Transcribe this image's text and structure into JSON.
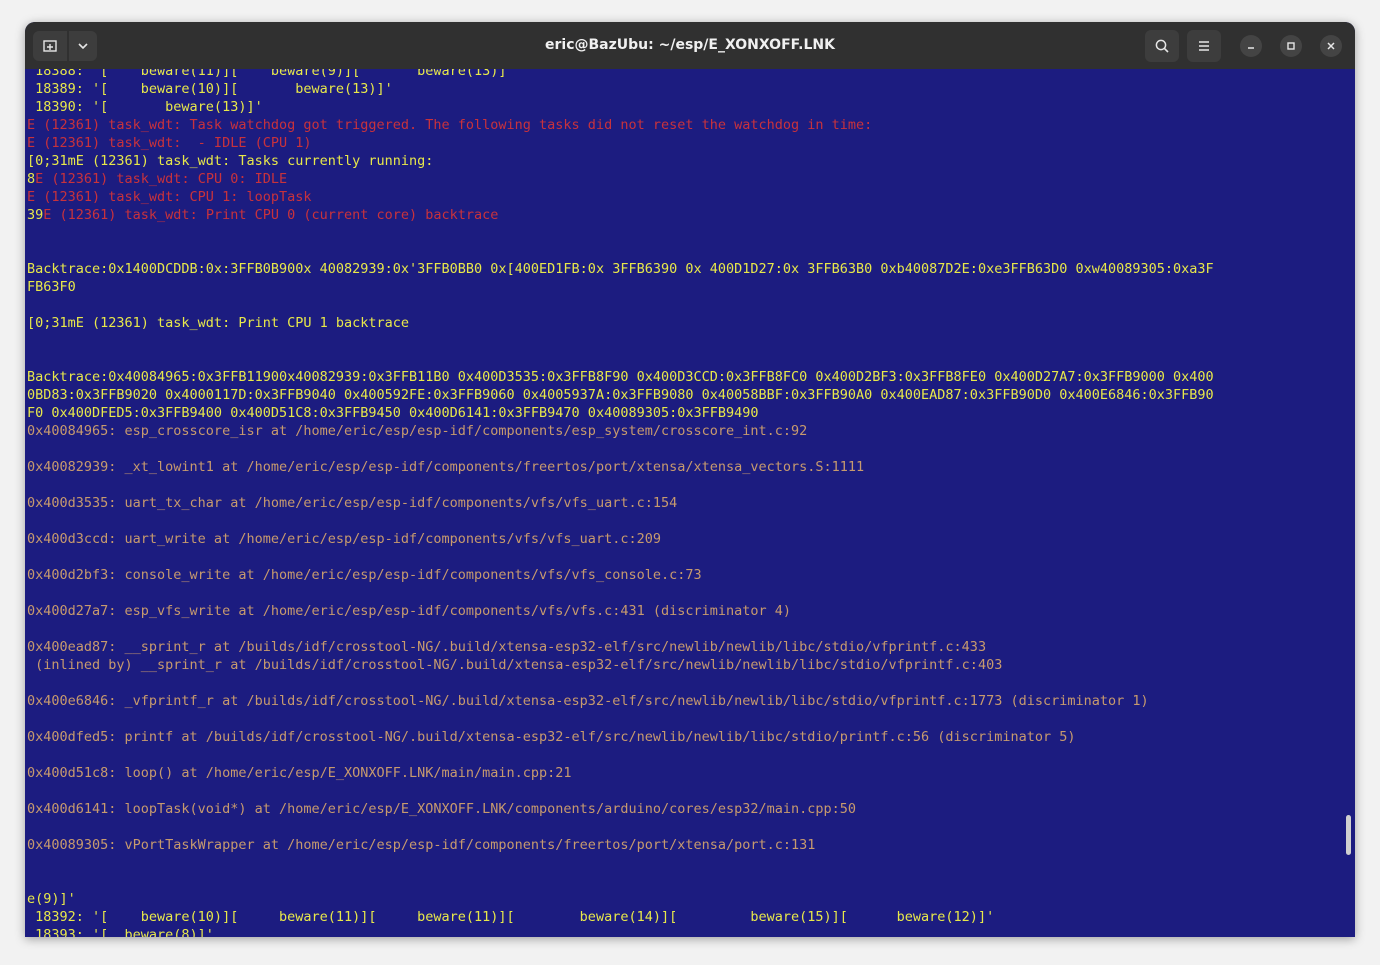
{
  "window": {
    "title": "eric@BazUbu: ~/esp/E_XONXOFF.LNK"
  },
  "colors": {
    "background": "#1c1c80",
    "yellow": "#e8e84a",
    "red": "#c8323c",
    "brown": "#c79a6e",
    "titlebar": "#303030"
  },
  "terminal": {
    "lines": [
      {
        "segments": [
          {
            "text": " 18388: '[    beware(11)][    beware(9)][       beware(13)]'",
            "color": "yellow"
          }
        ]
      },
      {
        "segments": [
          {
            "text": " 18389: '[    beware(10)][       beware(13)]'",
            "color": "yellow"
          }
        ]
      },
      {
        "segments": [
          {
            "text": " 18390: '[       beware(13)]'",
            "color": "yellow"
          }
        ]
      },
      {
        "segments": [
          {
            "text": "E (12361) task_wdt: Task watchdog got triggered. The following tasks did not reset the watchdog in time:",
            "color": "red"
          }
        ]
      },
      {
        "segments": [
          {
            "text": "E (12361) task_wdt:  - IDLE (CPU 1)",
            "color": "red"
          }
        ]
      },
      {
        "segments": [
          {
            "text": "[0;31mE (12361) task_wdt: Tasks currently running:",
            "color": "yellow"
          }
        ]
      },
      {
        "segments": [
          {
            "text": "8",
            "color": "yellow"
          },
          {
            "text": "E (12361) task_wdt: CPU 0: IDLE",
            "color": "red"
          }
        ]
      },
      {
        "segments": [
          {
            "text": "E (12361) task_wdt: CPU 1: loopTask",
            "color": "red"
          }
        ]
      },
      {
        "segments": [
          {
            "text": "39",
            "color": "yellow"
          },
          {
            "text": "E (12361) task_wdt: Print CPU 0 (current core) backtrace",
            "color": "red"
          }
        ]
      },
      {
        "segments": []
      },
      {
        "segments": []
      },
      {
        "segments": [
          {
            "text": "Backtrace:0x1400DCDDB:0x:3FFB0B900x 40082939:0x'3FFB0BB0 0x[400ED1FB:0x 3FFB6390 0x 400D1D27:0x 3FFB63B0 0xb40087D2E:0xe3FFB63D0 0xw40089305:0xa3F",
            "color": "yellow"
          }
        ]
      },
      {
        "segments": [
          {
            "text": "FB63F0",
            "color": "yellow"
          }
        ]
      },
      {
        "segments": []
      },
      {
        "segments": [
          {
            "text": "[0;31mE (12361) task_wdt: Print CPU 1 backtrace",
            "color": "yellow"
          }
        ]
      },
      {
        "segments": []
      },
      {
        "segments": []
      },
      {
        "segments": [
          {
            "text": "Backtrace:0x40084965:0x3FFB11900x40082939:0x3FFB11B0 0x400D3535:0x3FFB8F90 0x400D3CCD:0x3FFB8FC0 0x400D2BF3:0x3FFB8FE0 0x400D27A7:0x3FFB9000 0x400",
            "color": "yellow"
          }
        ]
      },
      {
        "segments": [
          {
            "text": "0BD83:0x3FFB9020 0x4000117D:0x3FFB9040 0x400592FE:0x3FFB9060 0x4005937A:0x3FFB9080 0x40058BBF:0x3FFB90A0 0x400EAD87:0x3FFB90D0 0x400E6846:0x3FFB90",
            "color": "yellow"
          }
        ]
      },
      {
        "segments": [
          {
            "text": "F0 0x400DFED5:0x3FFB9400 0x400D51C8:0x3FFB9450 0x400D6141:0x3FFB9470 0x40089305:0x3FFB9490",
            "color": "yellow"
          }
        ]
      },
      {
        "segments": [
          {
            "text": "0x40084965: esp_crosscore_isr at /home/eric/esp/esp-idf/components/esp_system/crosscore_int.c:92",
            "color": "brown"
          }
        ]
      },
      {
        "segments": []
      },
      {
        "segments": [
          {
            "text": "0x40082939: _xt_lowint1 at /home/eric/esp/esp-idf/components/freertos/port/xtensa/xtensa_vectors.S:1111",
            "color": "brown"
          }
        ]
      },
      {
        "segments": []
      },
      {
        "segments": [
          {
            "text": "0x400d3535: uart_tx_char at /home/eric/esp/esp-idf/components/vfs/vfs_uart.c:154",
            "color": "brown"
          }
        ]
      },
      {
        "segments": []
      },
      {
        "segments": [
          {
            "text": "0x400d3ccd: uart_write at /home/eric/esp/esp-idf/components/vfs/vfs_uart.c:209",
            "color": "brown"
          }
        ]
      },
      {
        "segments": []
      },
      {
        "segments": [
          {
            "text": "0x400d2bf3: console_write at /home/eric/esp/esp-idf/components/vfs/vfs_console.c:73",
            "color": "brown"
          }
        ]
      },
      {
        "segments": []
      },
      {
        "segments": [
          {
            "text": "0x400d27a7: esp_vfs_write at /home/eric/esp/esp-idf/components/vfs/vfs.c:431 (discriminator 4)",
            "color": "brown"
          }
        ]
      },
      {
        "segments": []
      },
      {
        "segments": [
          {
            "text": "0x400ead87: __sprint_r at /builds/idf/crosstool-NG/.build/xtensa-esp32-elf/src/newlib/newlib/libc/stdio/vfprintf.c:433",
            "color": "brown"
          }
        ]
      },
      {
        "segments": [
          {
            "text": " (inlined by) __sprint_r at /builds/idf/crosstool-NG/.build/xtensa-esp32-elf/src/newlib/newlib/libc/stdio/vfprintf.c:403",
            "color": "brown"
          }
        ]
      },
      {
        "segments": []
      },
      {
        "segments": [
          {
            "text": "0x400e6846: _vfprintf_r at /builds/idf/crosstool-NG/.build/xtensa-esp32-elf/src/newlib/newlib/libc/stdio/vfprintf.c:1773 (discriminator 1)",
            "color": "brown"
          }
        ]
      },
      {
        "segments": []
      },
      {
        "segments": [
          {
            "text": "0x400dfed5: printf at /builds/idf/crosstool-NG/.build/xtensa-esp32-elf/src/newlib/newlib/libc/stdio/printf.c:56 (discriminator 5)",
            "color": "brown"
          }
        ]
      },
      {
        "segments": []
      },
      {
        "segments": [
          {
            "text": "0x400d51c8: loop() at /home/eric/esp/E_XONXOFF.LNK/main/main.cpp:21",
            "color": "brown"
          }
        ]
      },
      {
        "segments": []
      },
      {
        "segments": [
          {
            "text": "0x400d6141: loopTask(void*) at /home/eric/esp/E_XONXOFF.LNK/components/arduino/cores/esp32/main.cpp:50",
            "color": "brown"
          }
        ]
      },
      {
        "segments": []
      },
      {
        "segments": [
          {
            "text": "0x40089305: vPortTaskWrapper at /home/eric/esp/esp-idf/components/freertos/port/xtensa/port.c:131",
            "color": "brown"
          }
        ]
      },
      {
        "segments": []
      },
      {
        "segments": []
      },
      {
        "segments": [
          {
            "text": "e(9)]'",
            "color": "yellow"
          }
        ]
      },
      {
        "segments": [
          {
            "text": " 18392: '[    beware(10)][     beware(11)][     beware(11)][        beware(14)][         beware(15)][      beware(12)]'",
            "color": "yellow"
          }
        ]
      },
      {
        "segments": [
          {
            "text": " 18393: '[  beware(8)]'",
            "color": "yellow"
          }
        ]
      }
    ]
  }
}
